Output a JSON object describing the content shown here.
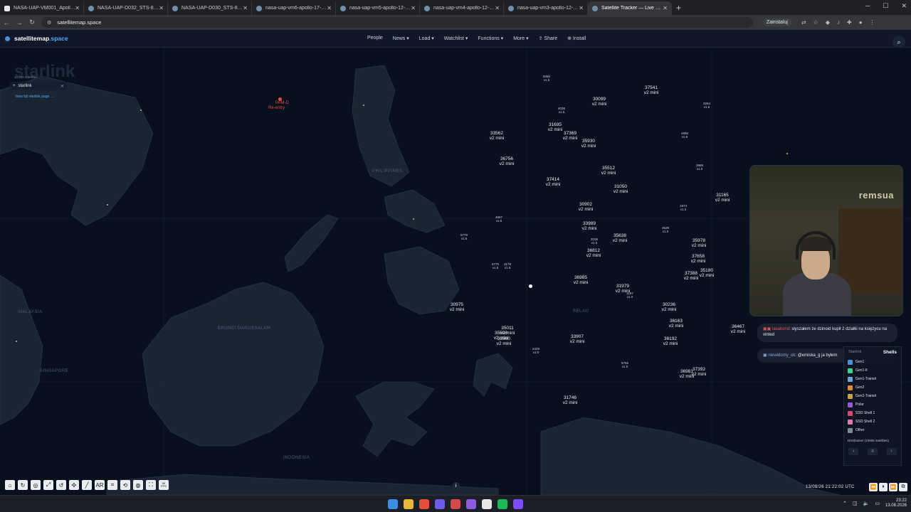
{
  "browser": {
    "tabs": [
      {
        "title": "NASA-UAP-VM001_Apollo 12...",
        "active": false,
        "favicon": "nasa"
      },
      {
        "title": "NASA-UAP-D032_STS-80-Unid...",
        "active": false,
        "favicon": "globe"
      },
      {
        "title": "NASA-UAP-D030_STS-80-Unid...",
        "active": false,
        "favicon": "globe"
      },
      {
        "title": "nasa-uap-vm6-apollo-17-1972...",
        "active": false,
        "favicon": "globe"
      },
      {
        "title": "nasa-uap-vm5-apollo-12-1969...",
        "active": false,
        "favicon": "globe"
      },
      {
        "title": "nasa-uap-vm4-apollo-12-1969...",
        "active": false,
        "favicon": "globe"
      },
      {
        "title": "nasa-uap-vm3-apollo-12-1969...",
        "active": false,
        "favicon": "globe"
      },
      {
        "title": "Satellite Tracker — Live Map of...",
        "active": true,
        "favicon": "globe"
      }
    ],
    "url": "satellitemap.space",
    "translate_label": "Zainstaluj"
  },
  "site": {
    "logo_main": "satellitemap",
    "logo_ext": ".space",
    "nav": [
      "People",
      "News ▾",
      "Load ▾",
      "Watchlist ▾",
      "Functions ▾",
      "More ▾",
      "⇪ Share",
      "⊕ Install"
    ]
  },
  "left_panel": {
    "watermark": "starlink",
    "subtitle": "10,906 satellites",
    "tag": "starlink",
    "link": "View full starlink page →"
  },
  "reentry": {
    "name": "PAM-D",
    "status": "Re-entry"
  },
  "map_labels": [
    {
      "text": "PHILIPPINES"
    },
    {
      "text": "MALAYSIA"
    },
    {
      "text": "INDONESIA"
    },
    {
      "text": "BELAU"
    },
    {
      "text": "SINGAPORE"
    },
    {
      "text": "BRUNEI DARUSSALAM"
    }
  ],
  "satellites": [
    {
      "id": "5060",
      "type": "v1.5",
      "small": true
    },
    {
      "id": "37541",
      "type": "v2 mini",
      "small": false
    },
    {
      "id": "30099",
      "type": "v2 mini",
      "small": false
    },
    {
      "id": "3264",
      "type": "v1.5",
      "small": true
    },
    {
      "id": "4036",
      "type": "v1.5",
      "small": true
    },
    {
      "id": "31695",
      "type": "v2 mini",
      "small": false
    },
    {
      "id": "33562",
      "type": "v2 mini",
      "small": false
    },
    {
      "id": "37369",
      "type": "v2 mini",
      "small": false
    },
    {
      "id": "35930",
      "type": "v2 mini",
      "small": false
    },
    {
      "id": "4690",
      "type": "v1.5",
      "small": true
    },
    {
      "id": "36756",
      "type": "v2 mini",
      "small": false
    },
    {
      "id": "3866",
      "type": "v1.5",
      "small": true
    },
    {
      "id": "35512",
      "type": "v2 mini",
      "small": false
    },
    {
      "id": "37414",
      "type": "v2 mini",
      "small": false
    },
    {
      "id": "31050",
      "type": "v2 mini",
      "small": false
    },
    {
      "id": "31165",
      "type": "v2 mini",
      "small": false
    },
    {
      "id": "30902",
      "type": "v2 mini",
      "small": false
    },
    {
      "id": "1973",
      "type": "v1.0",
      "small": true
    },
    {
      "id": "4667",
      "type": "v1.5",
      "small": true
    },
    {
      "id": "33989",
      "type": "v2 mini",
      "small": false
    },
    {
      "id": "2639",
      "type": "v1.0",
      "small": true
    },
    {
      "id": "5779",
      "type": "v1.5",
      "small": true
    },
    {
      "id": "35638",
      "type": "v2 mini",
      "small": false
    },
    {
      "id": "3106",
      "type": "v1.5",
      "small": true
    },
    {
      "id": "35978",
      "type": "v2 mini",
      "small": false
    },
    {
      "id": "36812",
      "type": "v2 mini",
      "small": false
    },
    {
      "id": "37658",
      "type": "v2 mini",
      "small": false
    },
    {
      "id": "5775",
      "type": "v1.5",
      "small": true
    },
    {
      "id": "3179",
      "type": "v1.5",
      "small": true
    },
    {
      "id": "35180",
      "type": "v2 mini",
      "small": false
    },
    {
      "id": "37388",
      "type": "v2 mini",
      "small": false
    },
    {
      "id": "36985",
      "type": "v2 mini",
      "small": false
    },
    {
      "id": "31979",
      "type": "v2 mini",
      "small": false
    },
    {
      "id": "1187",
      "type": "v1.0",
      "small": true
    },
    {
      "id": "30975",
      "type": "v2 mini",
      "small": false
    },
    {
      "id": "30236",
      "type": "v2 mini",
      "small": false
    },
    {
      "id": "36163",
      "type": "v2 mini",
      "small": false
    },
    {
      "id": "36467",
      "type": "v2 mini",
      "small": false
    },
    {
      "id": "35011",
      "type": "v2 mini",
      "small": false
    },
    {
      "id": "35506",
      "type": "v2 mini",
      "small": false
    },
    {
      "id": "33560",
      "type": "v2 mini",
      "small": false
    },
    {
      "id": "33907",
      "type": "v2 mini",
      "small": false
    },
    {
      "id": "36192",
      "type": "v2 mini",
      "small": false
    },
    {
      "id": "2429",
      "type": "v1.0",
      "small": true
    },
    {
      "id": "6765",
      "type": "v1.5",
      "small": true
    },
    {
      "id": "36981",
      "type": "v2 mini",
      "small": false
    },
    {
      "id": "37392",
      "type": "v2 mini",
      "small": false
    },
    {
      "id": "31746",
      "type": "v2 mini",
      "small": false
    }
  ],
  "webcam": {
    "sign": "remsua"
  },
  "chat": [
    {
      "user": "lasakond",
      "text": ": słyszałem że dzinoid kupił 2 działki na księżycu na vinted"
    },
    {
      "user": "niewidomy_ok",
      "text": ": @emiska_g ja byłem"
    }
  ],
  "legend": {
    "tab_inactive": "Starlink",
    "tab_active": "Shells",
    "items": [
      {
        "label": "Gen1",
        "color": "#4a90d9"
      },
      {
        "label": "Gen1-II",
        "color": "#3ecf8e"
      },
      {
        "label": "Gen1-Transit",
        "color": "#6fa8dc"
      },
      {
        "label": "Gen2",
        "color": "#e0893a"
      },
      {
        "label": "Gen2-Transit",
        "color": "#c9a046"
      },
      {
        "label": "Polar",
        "color": "#9b59d0"
      },
      {
        "label": "SSO Shell 1",
        "color": "#d9457a"
      },
      {
        "label": "SSO Shell 2",
        "color": "#e07ab0"
      },
      {
        "label": "Other",
        "color": "#7d8797"
      }
    ],
    "distribution": "Distribution (10906 satellites)",
    "controls": [
      "‹",
      "≡",
      "›"
    ]
  },
  "toolbar": {
    "tools": [
      "⌂",
      "↻",
      "◎",
      "⤢",
      "↺",
      "✣",
      "╱",
      "AR",
      "⌗",
      "⟲",
      "◍",
      "⛶"
    ],
    "fps_top": "60",
    "fps_bottom": "FPS"
  },
  "status": {
    "datetime": "13/08/26  21:22:02  UTC",
    "playback": [
      "⏪",
      "⏸",
      "⏩",
      "⧉"
    ]
  },
  "taskbar": {
    "time": "23:22",
    "date": "13.08.2026",
    "icons": [
      {
        "name": "windows-start",
        "color": "#3a8ee6"
      },
      {
        "name": "file-explorer",
        "color": "#e7b73a"
      },
      {
        "name": "chrome",
        "color": "#e44c3c"
      },
      {
        "name": "app-a",
        "color": "#6c5ce7"
      },
      {
        "name": "app-b",
        "color": "#d34a4a"
      },
      {
        "name": "app-c",
        "color": "#8e5be0"
      },
      {
        "name": "app-d",
        "color": "#e8e8e8"
      },
      {
        "name": "spotify",
        "color": "#1db954"
      },
      {
        "name": "app-e",
        "color": "#7c4dff"
      }
    ]
  }
}
